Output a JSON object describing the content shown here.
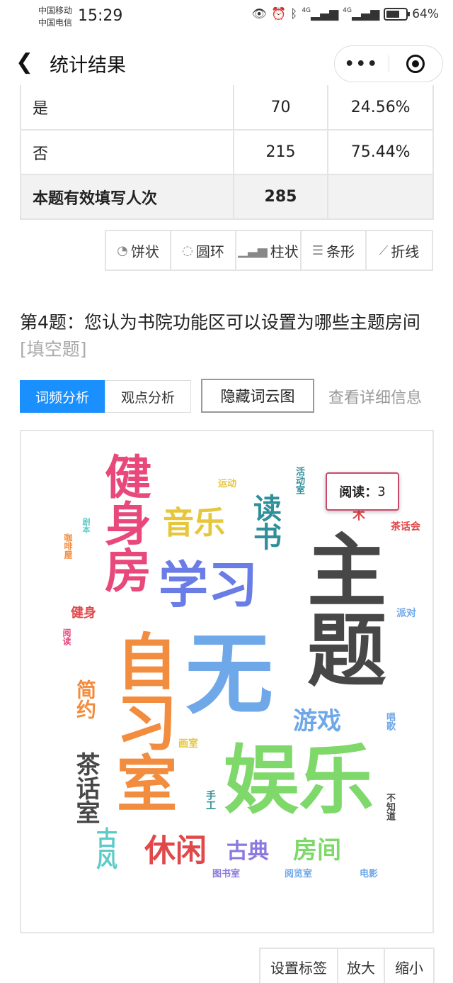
{
  "status_bar": {
    "carrier1": "中国移动",
    "carrier2": "中国电信",
    "time": "15:29",
    "battery": "64%",
    "net1": "4G",
    "net2": "4G"
  },
  "nav": {
    "title": "统计结果",
    "more": "•••"
  },
  "table": {
    "rows": [
      {
        "option": "是",
        "count": "70",
        "percent": "24.56%"
      },
      {
        "option": "否",
        "count": "215",
        "percent": "75.44%"
      }
    ],
    "total_label": "本题有效填写人次",
    "total_count": "285"
  },
  "chart_types": [
    {
      "label": "饼状",
      "icon": "pie-icon"
    },
    {
      "label": "圆环",
      "icon": "donut-icon"
    },
    {
      "label": "柱状",
      "icon": "bar-icon"
    },
    {
      "label": "条形",
      "icon": "hbar-icon"
    },
    {
      "label": "折线",
      "icon": "line-icon"
    }
  ],
  "question": {
    "text": "第4题：您认为书院功能区可以设置为哪些主题房间",
    "type": "[填空题]"
  },
  "tabs": {
    "freq": "词频分析",
    "view": "观点分析",
    "hide": "隐藏词云图",
    "detail": "查看详细信息"
  },
  "tooltip": {
    "word": "阅读：",
    "count": "3"
  },
  "cloud_words": {
    "zhuti": "主题",
    "wu": "无",
    "yule": "娱乐",
    "zixishi": "自习室",
    "jianshenfang": "健身房",
    "xuexi": "学习",
    "yinyue": "音乐",
    "dushu": "读书",
    "youxi": "游戏",
    "xiuxian": "休闲",
    "gudian": "古典",
    "fangjian": "房间",
    "chahuashi": "茶话室",
    "jianyue": "简约",
    "gufeng": "古风",
    "jianshen": "健身",
    "yundong": "运动",
    "huodongshi": "活动室",
    "chahuahui": "茶话会",
    "paidui": "派对",
    "changge": "唱歌",
    "buzhidao": "不知道",
    "dianying": "电影",
    "yuelanshi": "阅览室",
    "tushushi": "图书室",
    "shougong": "手工",
    "huashi": "画室",
    "yuedu": "阅读",
    "juben": "剧本",
    "kafeiwu": "咖啡屋",
    "yishu": "艺术"
  },
  "bottom_buttons": {
    "tags": "设置标签",
    "zoom_in": "放大",
    "zoom_out": "缩小"
  }
}
